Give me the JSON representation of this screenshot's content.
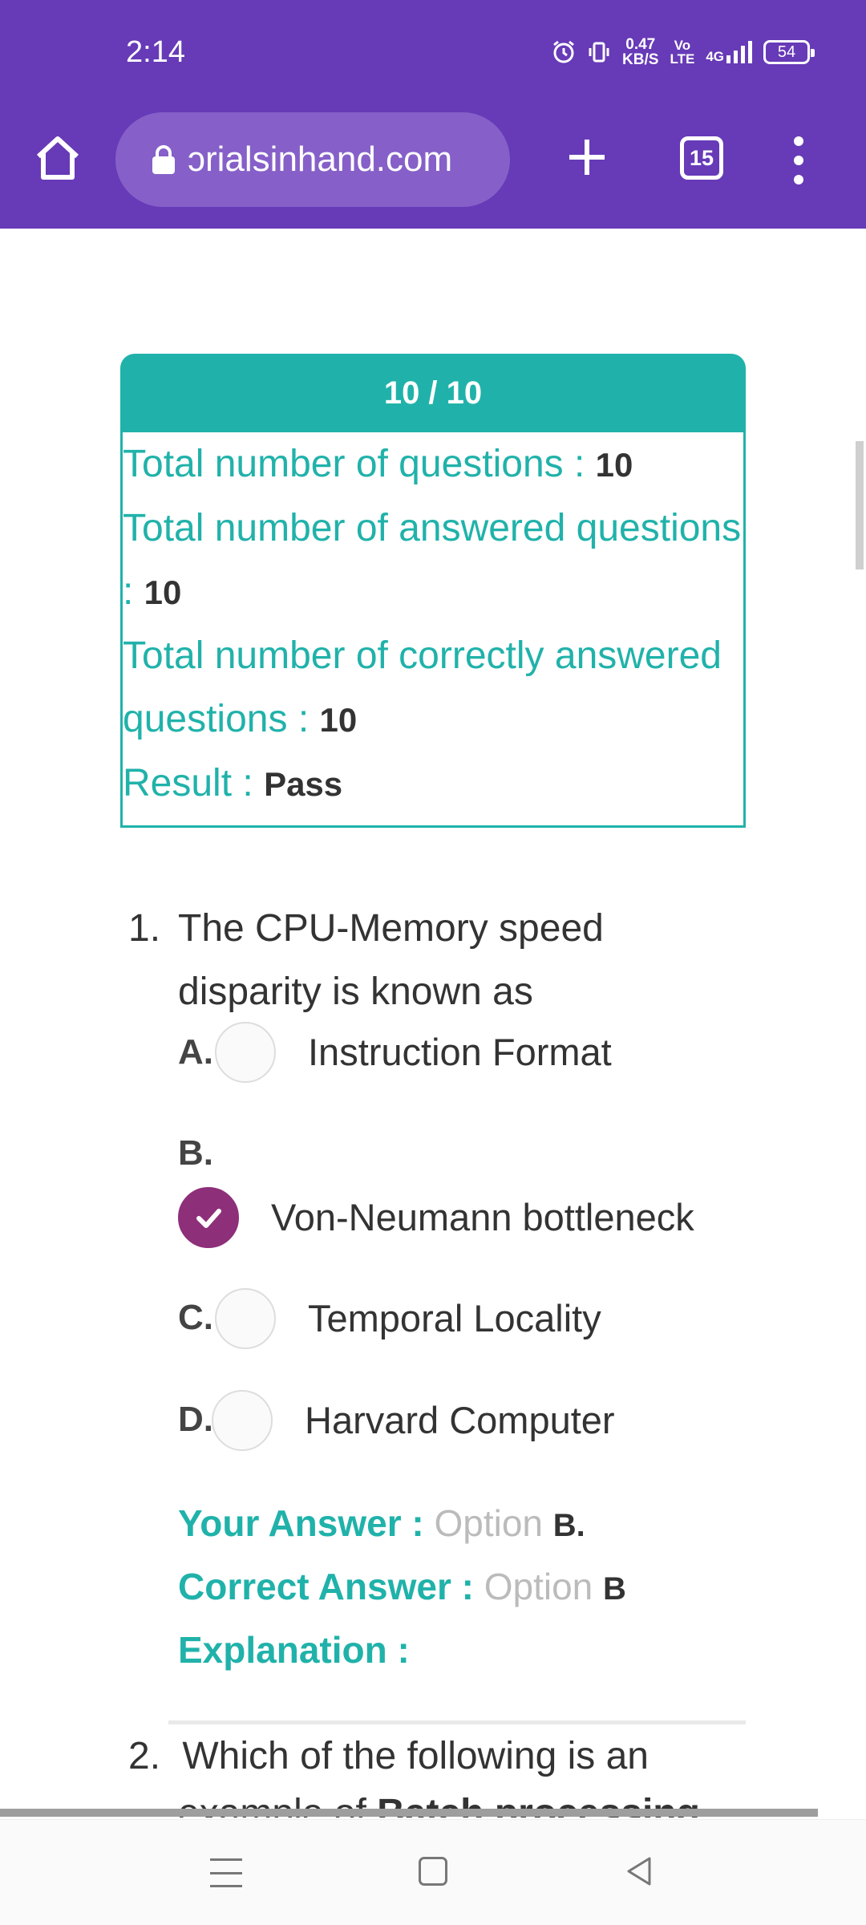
{
  "status_bar": {
    "time": "2:14",
    "net_speed_value": "0.47",
    "net_speed_unit": "KB/S",
    "volte_top": "Vo",
    "volte_bottom": "LTE",
    "network": "4G",
    "battery": "54",
    "icons": [
      "alarm-icon",
      "vibrate-icon",
      "signal-icon",
      "battery-icon"
    ]
  },
  "browser": {
    "url": "ɔrialsinhand.com",
    "tab_count": "15",
    "buttons": [
      "home-icon",
      "lock-icon",
      "plus-icon",
      "tabs-icon",
      "overflow-menu-icon"
    ]
  },
  "result": {
    "score": "10 / 10",
    "total_label": "Total number of questions : ",
    "total_value": "10",
    "answered_label": "Total number of answered questions",
    "answered_label_cont": ": ",
    "answered_value": "10",
    "correct_label": "Total number of correctly answered",
    "correct_label_cont": "questions : ",
    "correct_value": "10",
    "result_label": "Result : ",
    "result_value": "Pass"
  },
  "question1": {
    "number": "1.",
    "text": "The CPU-Memory speed disparity is known as",
    "options": [
      {
        "letter": "A.",
        "text": "Instruction Format",
        "selected": false
      },
      {
        "letter": "B.",
        "text": "Von-Neumann bottleneck",
        "selected": true
      },
      {
        "letter": "C.",
        "text": "Temporal Locality",
        "selected": false
      },
      {
        "letter": "D.",
        "text": "Harvard Computer",
        "selected": false
      }
    ],
    "your_answer_label": "Your Answer : ",
    "your_answer_option": "Option ",
    "your_answer_value": "B.",
    "correct_answer_label": "Correct Answer : ",
    "correct_answer_option": "Option ",
    "correct_answer_value": "B",
    "explanation_label": "Explanation :"
  },
  "question2": {
    "number": "2.",
    "text": "Which of the following is an",
    "text_cut": "example of ",
    "text_cut_bold": "Batch processing"
  },
  "colors": {
    "toolbar": "#673ab7",
    "teal": "#20b2aa",
    "selected": "#8e2f7a"
  }
}
